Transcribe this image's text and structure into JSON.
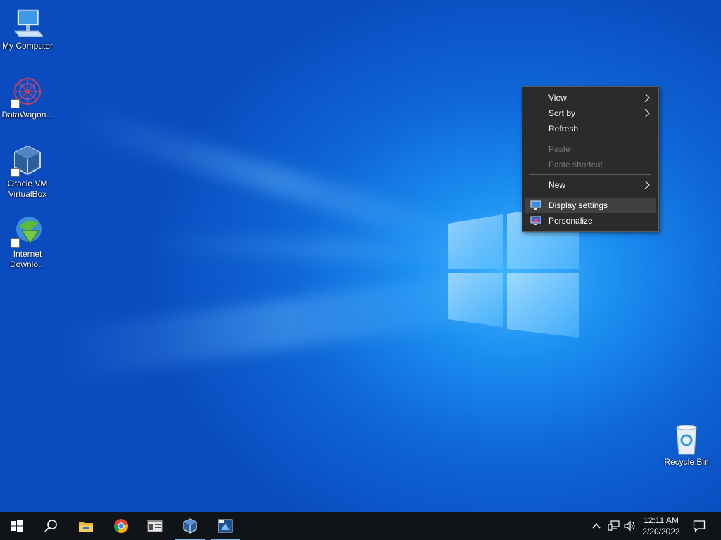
{
  "desktop": {
    "icons": [
      {
        "label": "My Computer"
      },
      {
        "label": "DataWagon..."
      },
      {
        "label": "Oracle VM VirtualBox"
      },
      {
        "label": "Internet Downlo..."
      },
      {
        "label": "Recycle Bin"
      }
    ]
  },
  "context_menu": {
    "items": [
      {
        "label": "View"
      },
      {
        "label": "Sort by"
      },
      {
        "label": "Refresh"
      },
      {
        "label": "Paste"
      },
      {
        "label": "Paste shortcut"
      },
      {
        "label": "New"
      },
      {
        "label": "Display settings"
      },
      {
        "label": "Personalize"
      }
    ]
  },
  "taskbar": {
    "apps": [
      "start-icon",
      "search-icon",
      "file-explorer-icon",
      "chrome-icon",
      "app-window-icon",
      "virtualbox-icon",
      "screenshot-tool-icon"
    ],
    "clock": {
      "time": "12:11 AM",
      "date": "2/20/2022"
    }
  },
  "colors": {
    "wallpaper": "#0f67d8",
    "menu_bg": "#2b2b2b",
    "taskbar_bg": "#101418",
    "active_indicator": "#7fb3e3"
  }
}
